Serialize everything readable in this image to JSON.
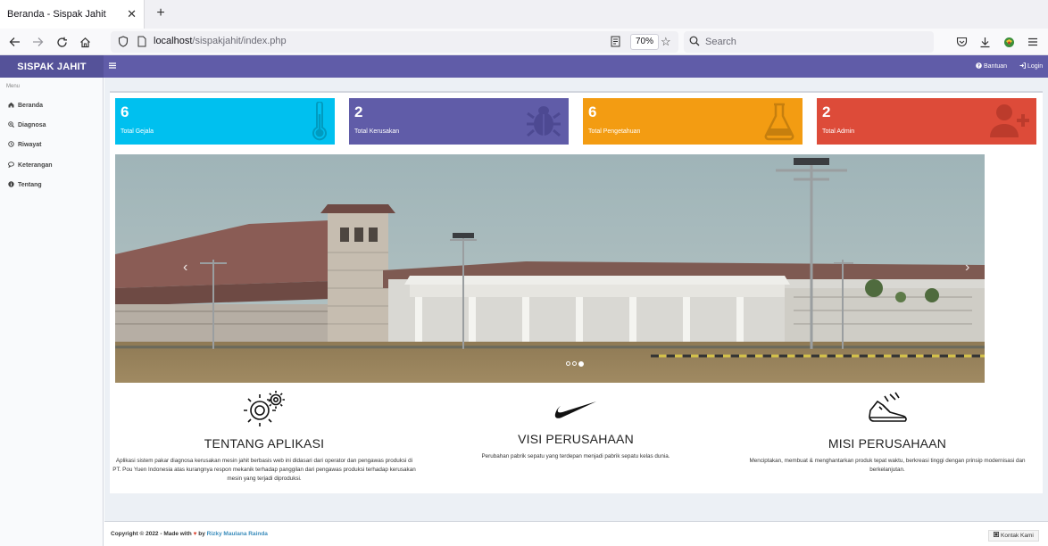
{
  "browser": {
    "tab_title": "Beranda - Sispak Jahit",
    "url_host": "localhost",
    "url_path": "/sispakjahit/index.php",
    "zoom": "70%",
    "search_placeholder": "Search"
  },
  "header": {
    "brand": "SISPAK JAHIT",
    "help_label": "Bantuan",
    "login_label": "Login",
    "color": "#605ca8"
  },
  "sidebar": {
    "menu_header": "Menu",
    "items": [
      {
        "label": "Beranda",
        "icon": "home-icon"
      },
      {
        "label": "Diagnosa",
        "icon": "search-plus-icon"
      },
      {
        "label": "Riwayat",
        "icon": "history-icon"
      },
      {
        "label": "Keterangan",
        "icon": "comment-icon"
      },
      {
        "label": "Tentang",
        "icon": "info-circle-icon"
      }
    ]
  },
  "stats": [
    {
      "value": "6",
      "label": "Total Gejala",
      "color": "#00c0ef",
      "icon": "thermometer-icon"
    },
    {
      "value": "2",
      "label": "Total Kerusakan",
      "color": "#605ca8",
      "icon": "bug-icon"
    },
    {
      "value": "6",
      "label": "Total Pengetahuan",
      "color": "#f39c12",
      "icon": "flask-icon"
    },
    {
      "value": "2",
      "label": "Total Admin",
      "color": "#dd4b39",
      "icon": "user-plus-icon"
    }
  ],
  "carousel": {
    "prev": "‹",
    "next": "›",
    "slide_count": 3,
    "active_index": 2
  },
  "info": [
    {
      "title": "TENTANG APLIKASI",
      "icon": "gears-icon",
      "text": "Aplikasi sistem pakar diagnosa kerusakan mesin jahit berbasis web ini didasari dari operator dan pengawas produksi di PT. Pou Yuen Indonesia atas kurangnya respon mekanik terhadap panggilan dari pengawas produksi terhadap kerusakan mesin yang terjadi diproduksi."
    },
    {
      "title": "VISI PERUSAHAAN",
      "icon": "swoosh-icon",
      "text": "Perubahan pabrik sepatu yang terdepan menjadi pabrik sepatu kelas dunia."
    },
    {
      "title": "MISI PERUSAHAAN",
      "icon": "running-shoe-icon",
      "text": "Menciptakan, membuat & menghantarkan produk tepat waktu, berkreasi tinggi dengan prinsip modernisasi dan berkelanjutan."
    }
  ],
  "footer": {
    "copyright": "Copyright © 2022 - Made with",
    "by": "by",
    "author": "Rizky Maulana Rainda",
    "contact_button": "Kontak Kami"
  }
}
